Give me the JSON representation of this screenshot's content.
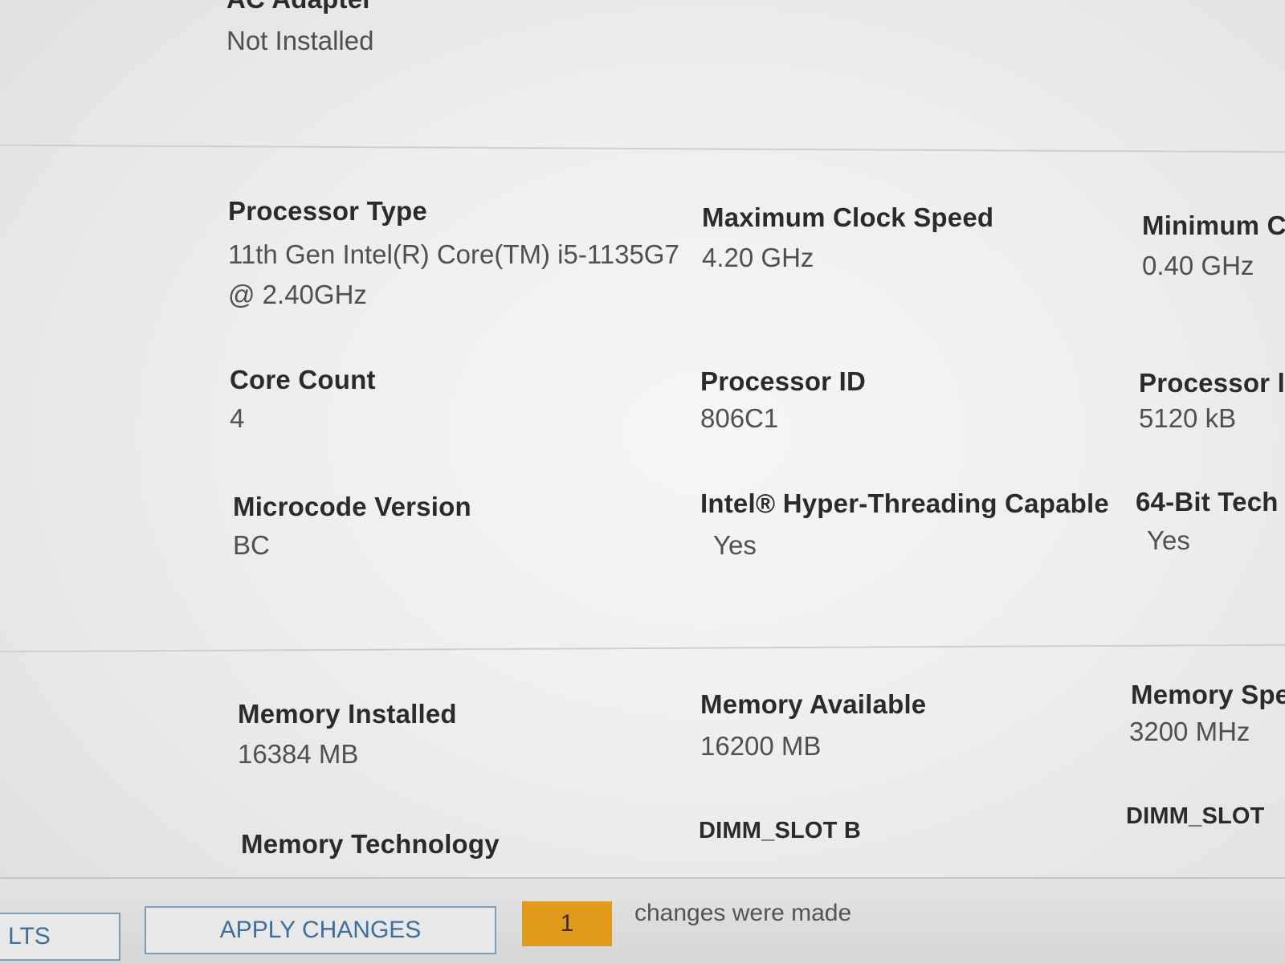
{
  "battery": {
    "ac_adapter_label": "AC Adapter",
    "ac_adapter_value": "Not Installed"
  },
  "processor": {
    "type_label": "Processor Type",
    "type_value_line1": "11th Gen Intel(R) Core(TM) i5-1135G7",
    "type_value_line2": "@ 2.40GHz",
    "max_clock_label": "Maximum Clock Speed",
    "max_clock_value": "4.20 GHz",
    "min_clock_label": "Minimum C",
    "min_clock_value": "0.40 GHz",
    "core_count_label": "Core Count",
    "core_count_value": "4",
    "processor_id_label": "Processor ID",
    "processor_id_value": "806C1",
    "cache_label": "Processor l",
    "cache_value": "5120 kB",
    "microcode_label": "Microcode Version",
    "microcode_value": "BC",
    "hyperthreading_label": "Intel® Hyper-Threading Capable",
    "hyperthreading_value": "Yes",
    "bit64_label": "64-Bit Tech",
    "bit64_value": "Yes"
  },
  "memory": {
    "installed_label": "Memory Installed",
    "installed_value": "16384 MB",
    "available_label": "Memory Available",
    "available_value": "16200 MB",
    "speed_label": "Memory Spe",
    "speed_value": "3200 MHz",
    "technology_label": "Memory Technology",
    "slot_b_label": "DIMM_SLOT B",
    "slot_label": "DIMM_SLOT"
  },
  "footer": {
    "left_button_label": "LTS",
    "apply_button_label": "APPLY CHANGES",
    "changes_count": "1",
    "changes_text": "changes were made"
  },
  "colors": {
    "accent_orange": "#e09a1c",
    "button_text_blue": "#3d6f9e"
  }
}
